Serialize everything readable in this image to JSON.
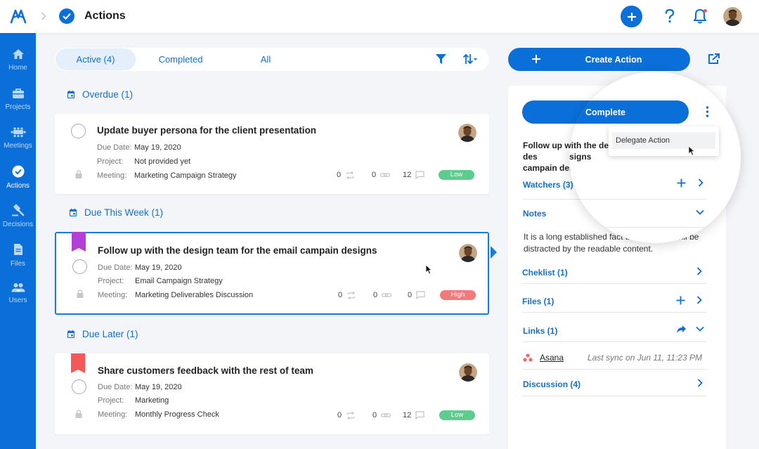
{
  "header": {
    "title": "Actions"
  },
  "sidebar": {
    "items": [
      {
        "label": "Home",
        "icon": "home-icon"
      },
      {
        "label": "Projects",
        "icon": "briefcase-icon"
      },
      {
        "label": "Meetings",
        "icon": "meetings-icon"
      },
      {
        "label": "Actions",
        "icon": "check-circle-icon",
        "active": true
      },
      {
        "label": "Decisions",
        "icon": "gavel-icon"
      },
      {
        "label": "Files",
        "icon": "file-icon"
      },
      {
        "label": "Users",
        "icon": "users-icon"
      }
    ]
  },
  "filters": {
    "tabs": [
      "Active (4)",
      "Completed",
      "All"
    ],
    "active_tab": "Active (4)"
  },
  "sections": {
    "overdue": "Overdue (1)",
    "this_week": "Due This Week (1)",
    "later": "Due Later (1)"
  },
  "labels": {
    "due": "Due Date:",
    "project": "Project:",
    "meeting": "Meeting:"
  },
  "actions": [
    {
      "title": "Update buyer persona for the client presentation",
      "due": "May 19, 2020",
      "project": "Not provided yet",
      "meeting": "Marketing Campaign Strategy",
      "recurring": "0",
      "links": "0",
      "comments": "12",
      "priority": "Low"
    },
    {
      "title": "Follow up with the design team for the email campain designs",
      "due": "May 19, 2020",
      "project": "Email Campaign Strategy",
      "meeting": "Marketing Deliverables Discussion",
      "recurring": "0",
      "links": "0",
      "comments": "0",
      "priority": "High",
      "flag_color": "#b23fd6"
    },
    {
      "title": "Share customers feedback with the rest of team",
      "due": "May 19, 2020",
      "project": "Marketing",
      "meeting": "Monthly Progress Check",
      "recurring": "0",
      "links": "0",
      "comments": "12",
      "priority": "Low",
      "flag_color": "#f25a5a"
    }
  ],
  "toolbar": {
    "create_label": "Create Action"
  },
  "detail": {
    "complete_label": "Complete",
    "title": "Follow up with the design team for the email campain designs",
    "title_visible": "Follow up with the des campain designs",
    "menu_item": "Delegate Action",
    "watchers": "Watchers (3)",
    "notes_label": "Notes",
    "notes_text": "It is a long established fact that a reader will be distracted by the readable content.",
    "checklist": "Cheklist (1)",
    "files": "Files (1)",
    "links": "Links (1)",
    "integration": "Asana",
    "sync": "Last sync on Jun 11, 11:23 PM",
    "discussion": "Discussion (4)"
  },
  "colors": {
    "primary": "#0a6fd8",
    "link": "#1470c9",
    "low": "#5ccd8e",
    "high": "#f37a7a"
  }
}
